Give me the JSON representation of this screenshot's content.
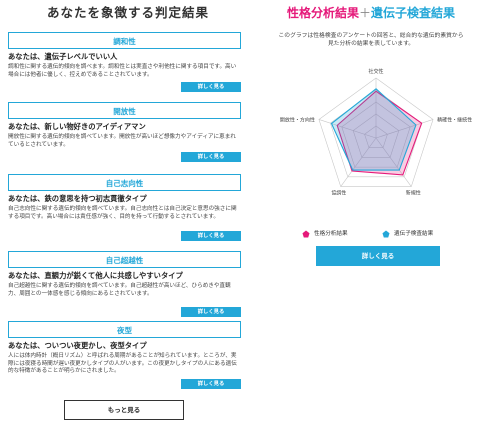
{
  "page_title": "あなたを象徴する判定結果",
  "cards": [
    {
      "heading": "調和性",
      "headline": "あなたは、遺伝子レベルでいい人",
      "text": "調和性に関する遺伝的傾向を調べます。調和性とは実直さや利他性に関する項目です。高い場合には他者に優しく、控えめであることされています。",
      "button": "詳しく見る"
    },
    {
      "heading": "開放性",
      "headline": "あなたは、新しい物好きのアイディアマン",
      "text": "開放性に関する遺伝的傾向を調べています。開放性が高いほど想像力やアイディアに恵まれているとされています。",
      "button": "詳しく見る"
    },
    {
      "heading": "自己志向性",
      "headline": "あなたは、鉄の意思を持つ初志貫徹タイプ",
      "text": "自己志向性に関する遺伝的傾向を調べています。自己志向性とは自己決定と意思の強さに関する項目です。高い場合には責任感が強く、目的を持って行動するとされています。",
      "button": "詳しく見る"
    },
    {
      "heading": "自己超越性",
      "headline": "あなたは、直観力が鋭くて他人に共感しやすいタイプ",
      "text": "自己超越性に関する遺伝的傾向を調べています。自己超越性が高いほど、ひらめきや直観力、周囲との一体感を感じる傾向にあるとされています。",
      "button": "詳しく見る"
    },
    {
      "heading": "夜型",
      "headline": "あなたは、ついつい夜更かし、夜型タイプ",
      "text": "人には体内時計（概日リズム）と呼ばれる周期があることが知られています。ところが、実際には夜寝る時間が遅い夜更かしタイプの人がいます。この夜更かしタイプの人にある遺伝的な特徴があることが明らかにされました。",
      "button": "詳しく見る"
    }
  ],
  "more_button": "もっと見る",
  "right": {
    "title_a": "性格分析結果",
    "title_plus": "＋",
    "title_b": "遺伝子検査結果",
    "description": "このグラフは性格検査のアンケートの回答と、総合的な遺伝的素質から見た分析の結果を表しています。",
    "legend_a": "性格分析結果",
    "legend_b": "遺伝子検査結果",
    "button": "詳しく見る"
  },
  "chart_data": {
    "type": "radar",
    "axes": [
      "社交性",
      "精確性・継続性",
      "新規性",
      "協調性",
      "開放性・方向性"
    ],
    "max": 5,
    "grid_levels": 5,
    "series": [
      {
        "name": "性格分析結果",
        "color": "#e5197a",
        "values": [
          3.9,
          4.0,
          3.8,
          3.4,
          3.4
        ]
      },
      {
        "name": "遺伝子検査結果",
        "color": "#23a7d8",
        "values": [
          4.1,
          3.5,
          3.3,
          3.3,
          3.9
        ]
      }
    ]
  },
  "colors": {
    "accent": "#23a7d8",
    "pink": "#e5197a"
  }
}
